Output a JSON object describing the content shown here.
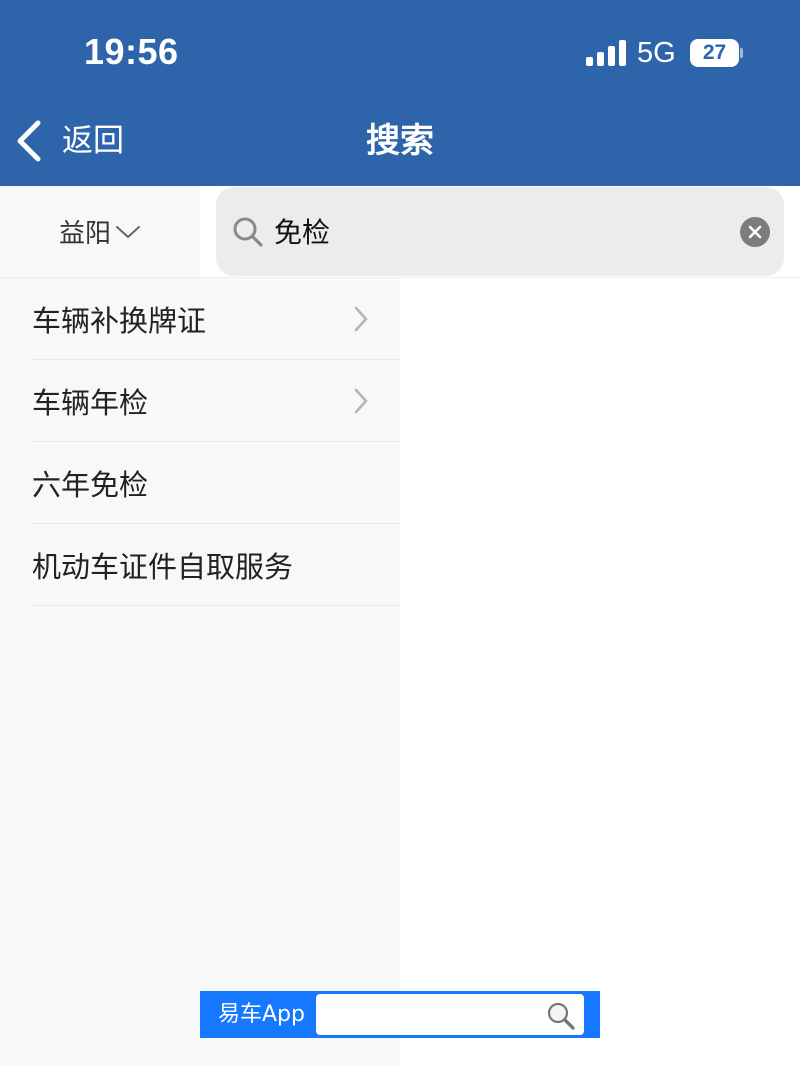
{
  "status_bar": {
    "time": "19:56",
    "network": "5G",
    "battery": "27"
  },
  "nav": {
    "back_label": "返回",
    "title": "搜索"
  },
  "search": {
    "city": "益阳",
    "query": "免检"
  },
  "results": [
    {
      "label": "车辆补换牌证",
      "has_arrow": true
    },
    {
      "label": "车辆年检",
      "has_arrow": true
    },
    {
      "label": "六年免检",
      "has_arrow": false
    },
    {
      "label": "机动车证件自取服务",
      "has_arrow": false
    }
  ],
  "watermark": {
    "label": "易车App"
  },
  "icons": {
    "back": "chevron-left-icon",
    "city_dropdown": "chevron-down-icon",
    "search": "search-icon",
    "clear": "clear-icon",
    "result_arrow": "chevron-right-icon",
    "watermark_search": "magnifier-icon"
  },
  "colors": {
    "header_bg": "#2d64aa",
    "list_bg": "#f6f8fa",
    "search_box_bg": "#ececec",
    "watermark_bg": "#1677ff"
  }
}
